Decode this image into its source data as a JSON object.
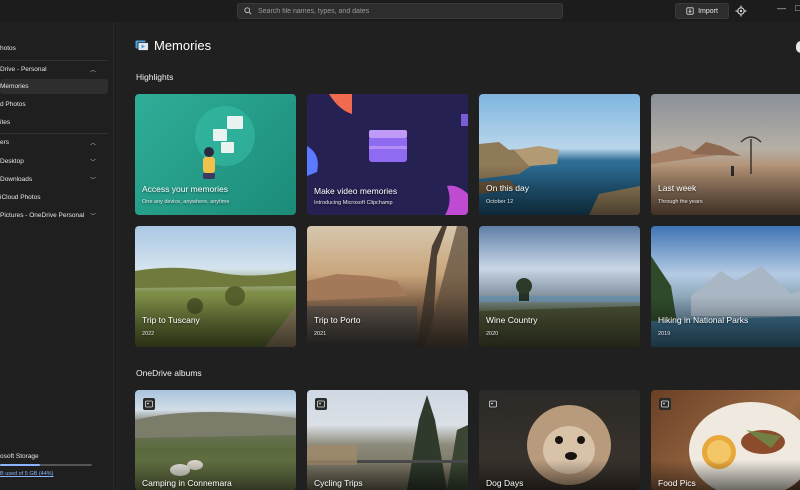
{
  "search": {
    "placeholder": "Search file names, types, and dates"
  },
  "toolbar": {
    "import_label": "Import"
  },
  "window": {
    "minimize": "—",
    "maximize": "□"
  },
  "sidebar": {
    "items": [
      {
        "label": "hotos"
      },
      {
        "label": "Drive - Personal"
      },
      {
        "label": "Memories"
      },
      {
        "label": "d Photos"
      },
      {
        "label": "ites"
      },
      {
        "label": "ers"
      },
      {
        "label": "Desktop"
      },
      {
        "label": "Downloads"
      },
      {
        "label": "iCloud Photos"
      },
      {
        "label": "Pictures - OneDrive Personal"
      }
    ],
    "storage": {
      "title": "osoft Storage",
      "usage_text": "B used of 5 GB (44%)",
      "percent": 44
    }
  },
  "main": {
    "title": "Memories",
    "highlights_title": "Highlights",
    "albums_title": "OneDrive albums",
    "highlights": [
      {
        "title": "Access your memories",
        "subtitle": "One any device, anywhere, anytime"
      },
      {
        "title": "Make video memories",
        "subtitle": "Introducing Microsoft Clipchamp"
      },
      {
        "title": "On this day",
        "subtitle": "October 12"
      },
      {
        "title": "Last week",
        "subtitle": "Through the years"
      },
      {
        "title": "Trip to Tuscany",
        "subtitle": "2022"
      },
      {
        "title": "Trip to Porto",
        "subtitle": "2021"
      },
      {
        "title": "Wine Country",
        "subtitle": "2020"
      },
      {
        "title": "Hiking in National Parks",
        "subtitle": "2019"
      }
    ],
    "albums": [
      {
        "title": "Camping in Connemara"
      },
      {
        "title": "Cycling Trips"
      },
      {
        "title": "Dog Days"
      },
      {
        "title": "Food Pics"
      }
    ]
  },
  "colors": {
    "accent": "#8ab4ff",
    "background": "#202020",
    "sidebar": "#1f1f1f"
  }
}
